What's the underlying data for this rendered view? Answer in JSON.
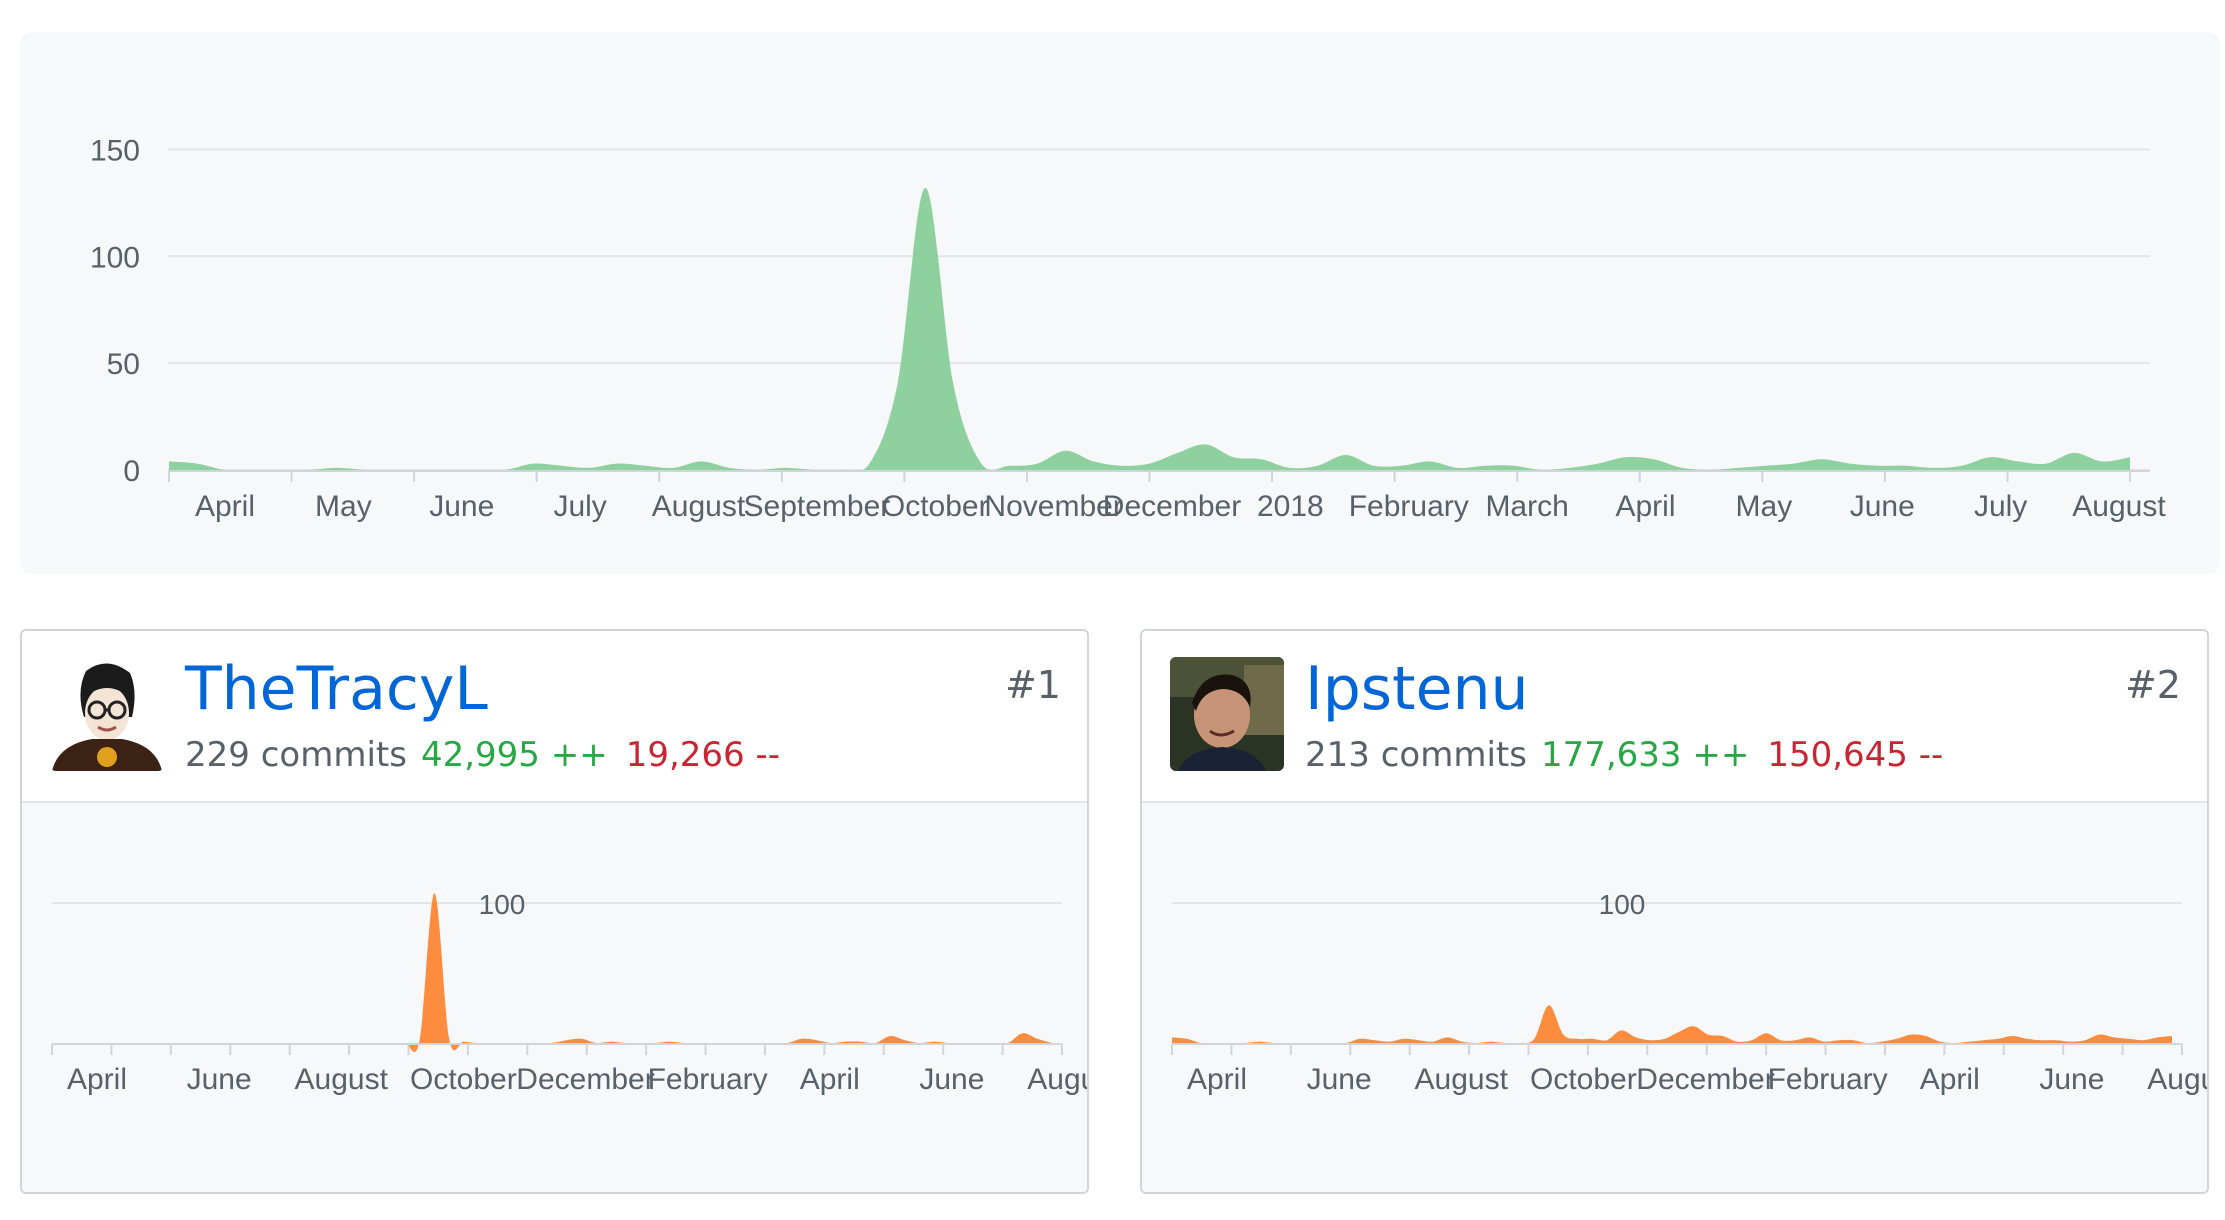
{
  "main_chart": {
    "y_ticks": [
      "150",
      "100",
      "50",
      "0"
    ],
    "x_labels": [
      "April",
      "May",
      "June",
      "July",
      "August",
      "September",
      "October",
      "November",
      "December",
      "2018",
      "February",
      "March",
      "April",
      "May",
      "June",
      "July",
      "August"
    ],
    "color": "#8fd19e"
  },
  "contributors": [
    {
      "rank": "#1",
      "username": "TheTracyL",
      "commits": "229 commits",
      "additions": "42,995 ++",
      "deletions": "19,266 --",
      "y_tick": "100",
      "x_labels": [
        "April",
        "June",
        "August",
        "October",
        "December",
        "February",
        "April",
        "June",
        "August"
      ]
    },
    {
      "rank": "#2",
      "username": "Ipstenu",
      "commits": "213 commits",
      "additions": "177,633 ++",
      "deletions": "150,645 --",
      "y_tick": "100",
      "x_labels": [
        "April",
        "June",
        "August",
        "October",
        "December",
        "February",
        "April",
        "June",
        "August"
      ]
    }
  ],
  "chart_data": [
    {
      "type": "area",
      "ylim": [
        0,
        160
      ],
      "y_ticks": [
        0,
        50,
        100,
        150
      ],
      "grid": true,
      "x_tick_labels": [
        "April",
        "May",
        "June",
        "July",
        "August",
        "September",
        "October",
        "November",
        "December",
        "2018",
        "February",
        "March",
        "April",
        "May",
        "June",
        "July",
        "August"
      ],
      "series": [
        {
          "values": [
            4,
            3,
            0,
            0,
            0,
            0,
            1,
            0,
            0,
            0,
            0,
            0,
            0,
            3,
            2,
            1,
            3,
            2,
            1,
            4,
            1,
            0,
            1,
            0,
            0,
            3,
            40,
            132,
            40,
            3,
            2,
            3,
            9,
            4,
            2,
            3,
            8,
            12,
            6,
            5,
            1,
            2,
            7,
            2,
            2,
            4,
            1,
            2,
            2,
            0,
            1,
            3,
            6,
            5,
            1,
            0,
            1,
            2,
            3,
            5,
            3,
            2,
            2,
            1,
            2,
            6,
            4,
            3,
            8,
            4,
            6
          ]
        }
      ]
    },
    {
      "type": "area",
      "ylim": [
        0,
        120
      ],
      "y_ticks": [
        100
      ],
      "grid": true,
      "x_tick_labels": [
        "April",
        "June",
        "August",
        "October",
        "December",
        "February",
        "April",
        "June",
        "August"
      ],
      "series": [
        {
          "values": [
            0,
            0,
            0,
            0,
            0,
            0,
            0,
            0,
            0,
            0,
            0,
            0,
            0,
            0,
            0,
            0,
            0,
            0,
            0,
            0,
            0,
            0,
            0,
            0,
            0,
            2,
            107,
            3,
            1,
            0,
            0,
            0,
            0,
            0,
            0,
            2,
            3,
            0,
            1,
            0,
            0,
            0,
            1,
            0,
            0,
            0,
            0,
            0,
            0,
            0,
            0,
            3,
            2,
            0,
            1,
            1,
            0,
            5,
            2,
            0,
            1,
            0,
            0,
            0,
            0,
            0,
            7,
            3,
            0
          ]
        }
      ]
    },
    {
      "type": "area",
      "ylim": [
        0,
        120
      ],
      "y_ticks": [
        100
      ],
      "grid": true,
      "x_tick_labels": [
        "April",
        "June",
        "August",
        "October",
        "December",
        "February",
        "April",
        "June",
        "August"
      ],
      "series": [
        {
          "values": [
            4,
            3,
            0,
            0,
            0,
            0,
            1,
            0,
            0,
            0,
            0,
            0,
            0,
            3,
            2,
            1,
            3,
            2,
            1,
            4,
            1,
            0,
            1,
            0,
            0,
            3,
            27,
            6,
            3,
            3,
            2,
            9,
            4,
            2,
            3,
            8,
            12,
            6,
            5,
            1,
            2,
            7,
            2,
            2,
            4,
            1,
            2,
            2,
            0,
            1,
            3,
            6,
            5,
            1,
            0,
            1,
            2,
            3,
            5,
            3,
            2,
            2,
            1,
            2,
            6,
            4,
            3,
            2,
            4,
            5
          ]
        }
      ]
    }
  ]
}
